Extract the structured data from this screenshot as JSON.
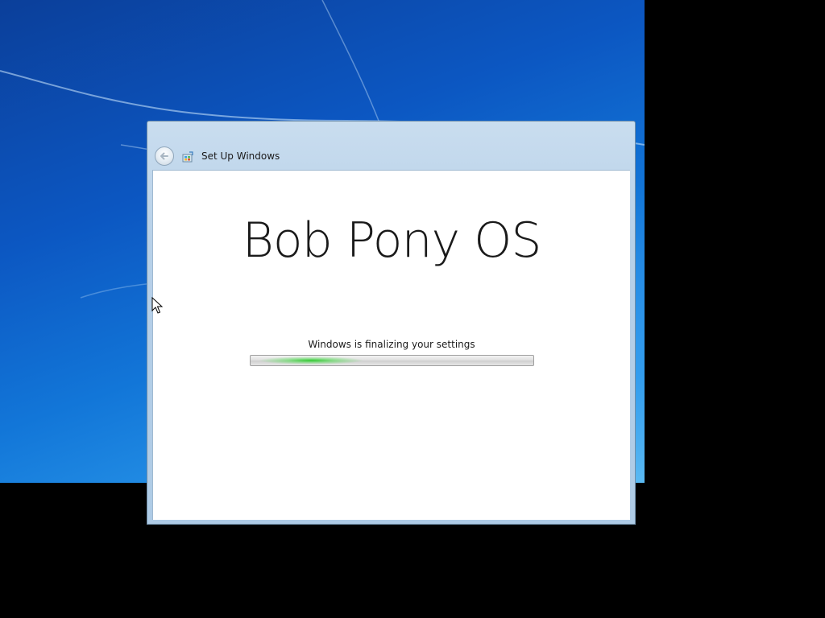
{
  "window": {
    "title": "Set Up Windows",
    "back_button_label": "Back",
    "back_button_enabled": false
  },
  "icons": {
    "back": "back-arrow-icon",
    "window": "setup-windows-icon",
    "cursor": "mouse-pointer-icon"
  },
  "main": {
    "brand": "Bob Pony OS",
    "status": "Windows is finalizing your settings",
    "progress": {
      "mode": "indeterminate",
      "glow_color": "#2fd23a"
    }
  },
  "colors": {
    "desktop": "#1276d8",
    "titlebar": "#b7d0e8",
    "content_bg": "#ffffff"
  }
}
